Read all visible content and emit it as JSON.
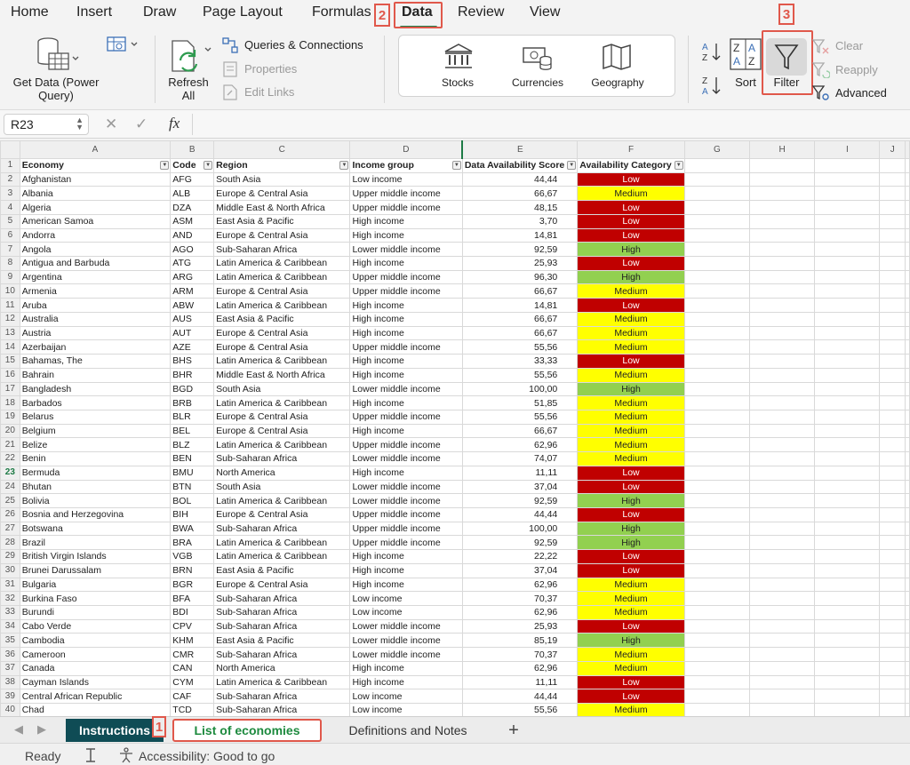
{
  "ribbon_tabs": [
    "Home",
    "Insert",
    "Draw",
    "Page Layout",
    "Formulas",
    "Data",
    "Review",
    "View"
  ],
  "active_tab": "Data",
  "callouts": [
    "1",
    "2",
    "3"
  ],
  "ribbon": {
    "get_data": [
      "Get Data (Power",
      "Query)"
    ],
    "refresh_all": [
      "Refresh",
      "All"
    ],
    "queries_connections": "Queries & Connections",
    "properties": "Properties",
    "edit_links": "Edit Links",
    "stocks": "Stocks",
    "currencies": "Currencies",
    "geography": "Geography",
    "sort": "Sort",
    "filter": "Filter",
    "clear": "Clear",
    "reapply": "Reapply",
    "advanced": "Advanced"
  },
  "formula_bar": {
    "name_box": "R23",
    "cancel": "✕",
    "enter": "✓",
    "fx": "fx",
    "formula": ""
  },
  "grid": {
    "column_letters": [
      "A",
      "B",
      "C",
      "D",
      "E",
      "F",
      "G",
      "H",
      "I",
      "J"
    ],
    "headers": [
      "Economy",
      "Code",
      "Region",
      "Income group",
      "Data Availability Score",
      "Availability Category"
    ],
    "selected_row": 23,
    "rows": [
      [
        "Afghanistan",
        "AFG",
        "South Asia",
        "Low income",
        "44,44",
        "Low"
      ],
      [
        "Albania",
        "ALB",
        "Europe & Central Asia",
        "Upper middle income",
        "66,67",
        "Medium"
      ],
      [
        "Algeria",
        "DZA",
        "Middle East & North Africa",
        "Upper middle income",
        "48,15",
        "Low"
      ],
      [
        "American Samoa",
        "ASM",
        "East Asia & Pacific",
        "High income",
        "3,70",
        "Low"
      ],
      [
        "Andorra",
        "AND",
        "Europe & Central Asia",
        "High income",
        "14,81",
        "Low"
      ],
      [
        "Angola",
        "AGO",
        "Sub-Saharan Africa",
        "Lower middle income",
        "92,59",
        "High"
      ],
      [
        "Antigua and Barbuda",
        "ATG",
        "Latin America & Caribbean",
        "High income",
        "25,93",
        "Low"
      ],
      [
        "Argentina",
        "ARG",
        "Latin America & Caribbean",
        "Upper middle income",
        "96,30",
        "High"
      ],
      [
        "Armenia",
        "ARM",
        "Europe & Central Asia",
        "Upper middle income",
        "66,67",
        "Medium"
      ],
      [
        "Aruba",
        "ABW",
        "Latin America & Caribbean",
        "High income",
        "14,81",
        "Low"
      ],
      [
        "Australia",
        "AUS",
        "East Asia & Pacific",
        "High income",
        "66,67",
        "Medium"
      ],
      [
        "Austria",
        "AUT",
        "Europe & Central Asia",
        "High income",
        "66,67",
        "Medium"
      ],
      [
        "Azerbaijan",
        "AZE",
        "Europe & Central Asia",
        "Upper middle income",
        "55,56",
        "Medium"
      ],
      [
        "Bahamas, The",
        "BHS",
        "Latin America & Caribbean",
        "High income",
        "33,33",
        "Low"
      ],
      [
        "Bahrain",
        "BHR",
        "Middle East & North Africa",
        "High income",
        "55,56",
        "Medium"
      ],
      [
        "Bangladesh",
        "BGD",
        "South Asia",
        "Lower middle income",
        "100,00",
        "High"
      ],
      [
        "Barbados",
        "BRB",
        "Latin America & Caribbean",
        "High income",
        "51,85",
        "Medium"
      ],
      [
        "Belarus",
        "BLR",
        "Europe & Central Asia",
        "Upper middle income",
        "55,56",
        "Medium"
      ],
      [
        "Belgium",
        "BEL",
        "Europe & Central Asia",
        "High income",
        "66,67",
        "Medium"
      ],
      [
        "Belize",
        "BLZ",
        "Latin America & Caribbean",
        "Upper middle income",
        "62,96",
        "Medium"
      ],
      [
        "Benin",
        "BEN",
        "Sub-Saharan Africa",
        "Lower middle income",
        "74,07",
        "Medium"
      ],
      [
        "Bermuda",
        "BMU",
        "North America",
        "High income",
        "11,11",
        "Low"
      ],
      [
        "Bhutan",
        "BTN",
        "South Asia",
        "Lower middle income",
        "37,04",
        "Low"
      ],
      [
        "Bolivia",
        "BOL",
        "Latin America & Caribbean",
        "Lower middle income",
        "92,59",
        "High"
      ],
      [
        "Bosnia and Herzegovina",
        "BIH",
        "Europe & Central Asia",
        "Upper middle income",
        "44,44",
        "Low"
      ],
      [
        "Botswana",
        "BWA",
        "Sub-Saharan Africa",
        "Upper middle income",
        "100,00",
        "High"
      ],
      [
        "Brazil",
        "BRA",
        "Latin America & Caribbean",
        "Upper middle income",
        "92,59",
        "High"
      ],
      [
        "British Virgin Islands",
        "VGB",
        "Latin America & Caribbean",
        "High income",
        "22,22",
        "Low"
      ],
      [
        "Brunei Darussalam",
        "BRN",
        "East Asia & Pacific",
        "High income",
        "37,04",
        "Low"
      ],
      [
        "Bulgaria",
        "BGR",
        "Europe & Central Asia",
        "High income",
        "62,96",
        "Medium"
      ],
      [
        "Burkina Faso",
        "BFA",
        "Sub-Saharan Africa",
        "Low income",
        "70,37",
        "Medium"
      ],
      [
        "Burundi",
        "BDI",
        "Sub-Saharan Africa",
        "Low income",
        "62,96",
        "Medium"
      ],
      [
        "Cabo Verde",
        "CPV",
        "Sub-Saharan Africa",
        "Lower middle income",
        "25,93",
        "Low"
      ],
      [
        "Cambodia",
        "KHM",
        "East Asia & Pacific",
        "Lower middle income",
        "85,19",
        "High"
      ],
      [
        "Cameroon",
        "CMR",
        "Sub-Saharan Africa",
        "Lower middle income",
        "70,37",
        "Medium"
      ],
      [
        "Canada",
        "CAN",
        "North America",
        "High income",
        "62,96",
        "Medium"
      ],
      [
        "Cayman Islands",
        "CYM",
        "Latin America & Caribbean",
        "High income",
        "11,11",
        "Low"
      ],
      [
        "Central African Republic",
        "CAF",
        "Sub-Saharan Africa",
        "Low income",
        "44,44",
        "Low"
      ],
      [
        "Chad",
        "TCD",
        "Sub-Saharan Africa",
        "Low income",
        "55,56",
        "Medium"
      ]
    ]
  },
  "sheet_tabs": [
    "Instructions",
    "List of economies",
    "Definitions and Notes"
  ],
  "active_sheet": "List of economies",
  "add_sheet": "+",
  "status": {
    "ready": "Ready",
    "accessibility": "Accessibility: Good to go"
  },
  "colors": {
    "low": "#c00000",
    "medium": "#ffff00",
    "high": "#92d050",
    "accent": "#1d7a45",
    "callout": "#e0584b"
  }
}
